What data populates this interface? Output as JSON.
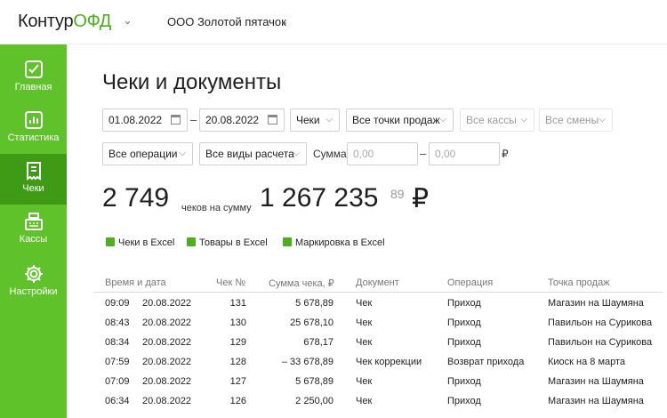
{
  "header": {
    "logo_part1": "Контур",
    "logo_part2": "ОФД",
    "org_name": "ООО Золотой пятачок"
  },
  "sidebar": {
    "items": [
      {
        "label": "Главная",
        "icon": "home-check-icon"
      },
      {
        "label": "Статистика",
        "icon": "chart-icon"
      },
      {
        "label": "Чеки",
        "icon": "receipt-icon",
        "active": true
      },
      {
        "label": "Кассы",
        "icon": "cash-register-icon"
      },
      {
        "label": "Настройки",
        "icon": "gear-icon"
      }
    ]
  },
  "page": {
    "title": "Чеки и документы"
  },
  "filters": {
    "date_from": "01.08.2022",
    "date_to": "20.08.2022",
    "doc_type": "Чеки",
    "points": "Все точки продаж",
    "registers": "Все кассы",
    "shifts": "Все смены",
    "operations": "Все операции",
    "payment_types": "Все виды расчета",
    "sum_label": "Сумма",
    "sum_from_placeholder": "0,00",
    "sum_to_placeholder": "0,00",
    "currency_sign": "₽",
    "dash": "–"
  },
  "summary": {
    "count": "2 749",
    "count_caption": "чеков на сумму",
    "amount": "1 267 235",
    "kopecks": "89",
    "currency": "₽"
  },
  "exports": {
    "checks": "Чеки в Excel",
    "goods": "Товары в Excel",
    "marking": "Маркировка в Excel"
  },
  "table": {
    "headers": {
      "datetime": "Время и дата",
      "number": "Чек №",
      "sum": "Сумма чека, ₽",
      "document": "Документ",
      "operation": "Операция",
      "point": "Точка продаж"
    },
    "rows": [
      {
        "time": "09:09",
        "date": "20.08.2022",
        "number": "131",
        "sum": "5 678,89",
        "document": "Чек",
        "operation": "Приход",
        "point": "Магазин на Шаумяна"
      },
      {
        "time": "08:43",
        "date": "20.08.2022",
        "number": "130",
        "sum": "25 678,10",
        "document": "Чек",
        "operation": "Приход",
        "point": "Павильон на Сурикова"
      },
      {
        "time": "08:34",
        "date": "20.08.2022",
        "number": "129",
        "sum": "678,17",
        "document": "Чек",
        "operation": "Приход",
        "point": "Павильон на Сурикова"
      },
      {
        "time": "07:59",
        "date": "20.08.2022",
        "number": "128",
        "sum": "– 33 678,89",
        "document": "Чек коррекции",
        "operation": "Возврат прихода",
        "point": "Киоск на 8 марта"
      },
      {
        "time": "07:09",
        "date": "20.08.2022",
        "number": "127",
        "sum": "5 678,89",
        "document": "Чек",
        "operation": "Приход",
        "point": "Магазин на Шаумяна"
      },
      {
        "time": "06:34",
        "date": "20.08.2022",
        "number": "126",
        "sum": "2 250,00",
        "document": "Чек",
        "operation": "Приход",
        "point": "Магазин на Шаумяна"
      }
    ]
  },
  "colors": {
    "brand_green": "#5fc22b",
    "active_green": "#3f9b16",
    "logo_green": "#4caf1f"
  }
}
